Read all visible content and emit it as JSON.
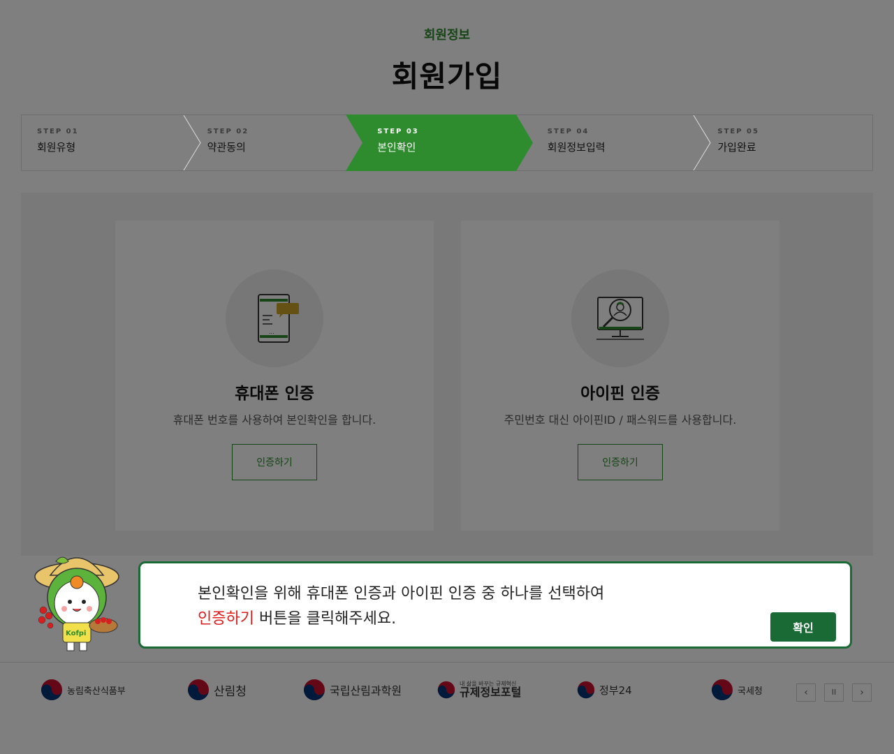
{
  "header": {
    "breadcrumb": "회원정보",
    "title": "회원가입"
  },
  "steps": [
    {
      "num": "STEP 01",
      "label": "회원유형",
      "active": false
    },
    {
      "num": "STEP 02",
      "label": "약관동의",
      "active": false
    },
    {
      "num": "STEP 03",
      "label": "본인확인",
      "active": true
    },
    {
      "num": "STEP 04",
      "label": "회원정보입력",
      "active": false
    },
    {
      "num": "STEP 05",
      "label": "가입완료",
      "active": false
    }
  ],
  "auth_options": [
    {
      "title": "휴대폰 인증",
      "desc": "휴대폰 번호를 사용하여 본인확인을 합니다.",
      "button": "인증하기",
      "icon": "mobile-phone-icon"
    },
    {
      "title": "아이핀 인증",
      "desc": "주민번호 대신 아이핀ID / 패스워드를 사용합니다.",
      "button": "인증하기",
      "icon": "ipin-monitor-icon"
    }
  ],
  "dialog": {
    "line1": "본인확인을 위해  휴대폰 인증과 아이핀 인증 중 하나를 선택하여",
    "line2_highlight": "인증하기",
    "line2_rest": " 버튼을 클릭해주세요.",
    "confirm": "확인"
  },
  "footer": {
    "logos": [
      "농림축산식품부",
      "산림청",
      "국립산림과학원",
      "규제정보포털",
      "정부24",
      "국세청"
    ],
    "portal_tagline": "내 삶을 바꾸는 규제혁신",
    "controls": [
      "‹",
      "II",
      "›"
    ]
  },
  "colors": {
    "primary_green": "#2e8b2e",
    "dialog_green": "#1a6a35",
    "highlight_red": "#e01b1b",
    "overlay": "rgba(0,0,0,0.5)"
  },
  "mascot_text": "Kofpi"
}
